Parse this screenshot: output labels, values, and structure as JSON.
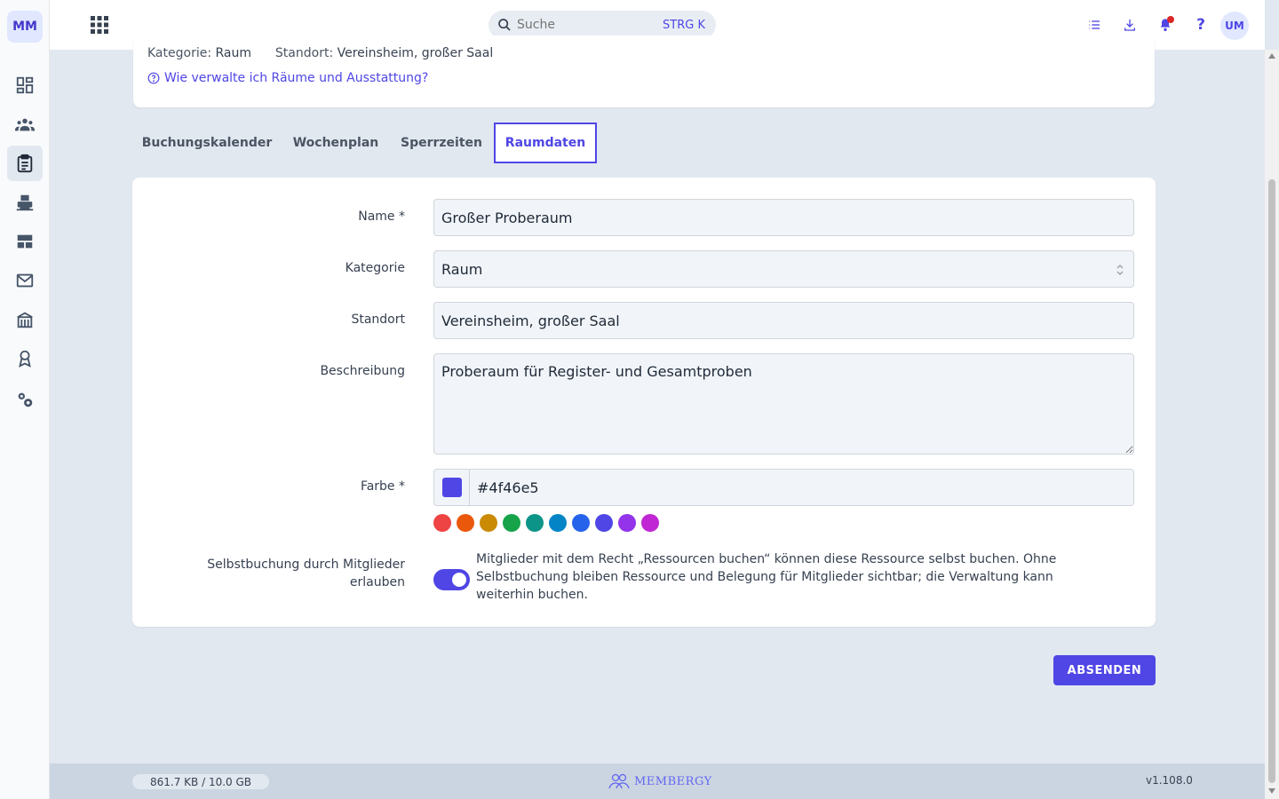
{
  "app": {
    "logo": "MM",
    "brand": "MEMBERGY"
  },
  "sidebar": {
    "items": [
      {
        "icon": "dashboard-icon"
      },
      {
        "icon": "members-icon"
      },
      {
        "icon": "clipboard-icon",
        "active": true
      },
      {
        "icon": "printer-icon"
      },
      {
        "icon": "table-icon"
      },
      {
        "icon": "mail-icon"
      },
      {
        "icon": "building-icon"
      },
      {
        "icon": "award-icon"
      },
      {
        "icon": "settings-icon"
      }
    ]
  },
  "topbar": {
    "search_placeholder": "Suche",
    "search_shortcut": "STRG K",
    "avatar": "UM"
  },
  "header": {
    "kategorie_label": "Kategorie:",
    "kategorie_value": "Raum",
    "standort_label": "Standort:",
    "standort_value": "Vereinsheim, großer Saal",
    "help_link": "Wie verwalte ich Räume und Ausstattung?"
  },
  "tabs": [
    {
      "label": "Buchungskalender"
    },
    {
      "label": "Wochenplan"
    },
    {
      "label": "Sperrzeiten"
    },
    {
      "label": "Raumdaten",
      "active": true
    }
  ],
  "form": {
    "name_label": "Name *",
    "name_value": "Großer Proberaum",
    "kategorie_label": "Kategorie",
    "kategorie_value": "Raum",
    "standort_label": "Standort",
    "standort_value": "Vereinsheim, großer Saal",
    "beschreibung_label": "Beschreibung",
    "beschreibung_value": "Proberaum für Register- und Gesamtproben",
    "farbe_label": "Farbe *",
    "farbe_value": "#4f46e5",
    "palette": [
      "#ef4444",
      "#ea580c",
      "#ca8a04",
      "#16a34a",
      "#0d9488",
      "#0284c7",
      "#2563eb",
      "#4f46e5",
      "#9333ea",
      "#c026d3"
    ],
    "selbstbuchung_label_1": "Selbstbuchung durch Mitglieder",
    "selbstbuchung_label_2": "erlauben",
    "selbstbuchung_enabled": true,
    "selbstbuchung_desc": "Mitglieder mit dem Recht „Ressourcen buchen“ können diese Ressource selbst buchen. Ohne Selbstbuchung bleiben Ressource und Belegung für Mitglieder sichtbar; die Verwaltung kann weiterhin buchen.",
    "submit_label": "ABSENDEN"
  },
  "footer": {
    "storage": "861.7 KB / 10.0 GB",
    "version": "v1.108.0"
  },
  "colors": {
    "accent": "#4f46e5",
    "notification": "#dc2626"
  }
}
